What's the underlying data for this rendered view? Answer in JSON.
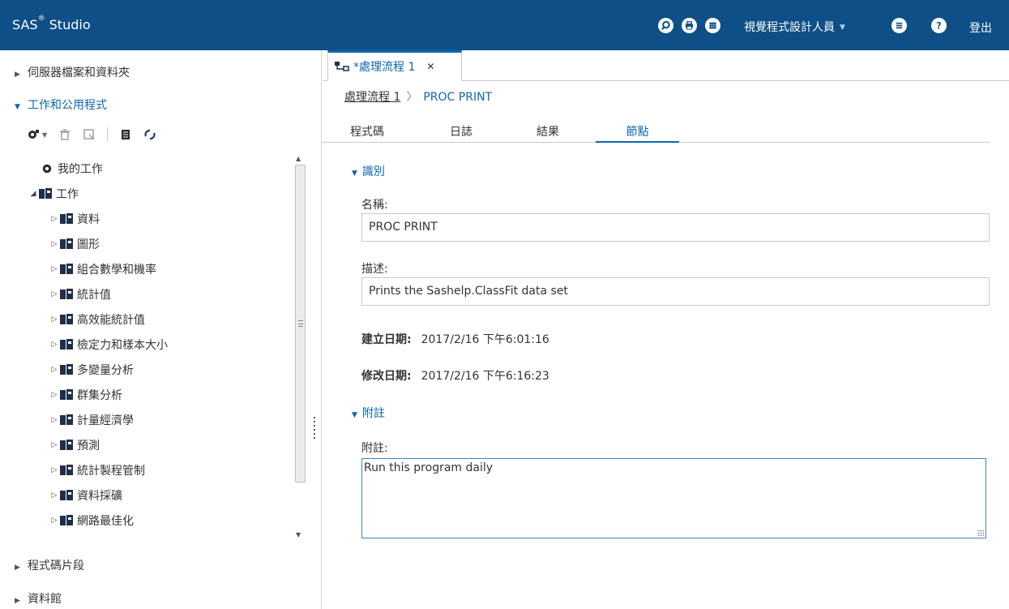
{
  "app": {
    "title": "SAS",
    "title_sup": "®",
    "title_rest": " Studio"
  },
  "topbar": {
    "icons": [
      "search-icon",
      "print-icon",
      "apps-icon",
      "menu-icon",
      "help-icon"
    ],
    "role_label": "視覺程式設計人員",
    "logout_label": "登出"
  },
  "left": {
    "sections": {
      "server_files": "伺服器檔案和資料夾",
      "tasks": "工作和公用程式",
      "snippets": "程式碼片段",
      "libraries": "資料館"
    },
    "tree": {
      "my_tasks": "我的工作",
      "tasks_root": "工作",
      "items": [
        "資料",
        "圖形",
        "組合數學和機率",
        "統計值",
        "高效能統計值",
        "檢定力和樣本大小",
        "多變量分析",
        "群集分析",
        "計量經濟學",
        "預測",
        "統計製程管制",
        "資料採礦",
        "網路最佳化"
      ]
    }
  },
  "right": {
    "tab_label": "*處理流程 1",
    "breadcrumb": {
      "parent": "處理流程 1",
      "current": "PROC PRINT"
    },
    "subtabs": [
      "程式碼",
      "日誌",
      "結果",
      "節點"
    ],
    "identity": {
      "heading": "識別",
      "name_label": "名稱:",
      "name_value": "PROC PRINT",
      "desc_label": "描述:",
      "desc_value": "Prints the Sashelp.ClassFit data set",
      "created_label": "建立日期:",
      "created_value": "2017/2/16 下午6:01:16",
      "modified_label": "修改日期:",
      "modified_value": "2017/2/16 下午6:16:23"
    },
    "notes": {
      "heading": "附註",
      "label": "附註:",
      "value": "Run this program daily"
    }
  },
  "colors": {
    "brand": "#0d4f86",
    "accent": "#0d66b1"
  }
}
